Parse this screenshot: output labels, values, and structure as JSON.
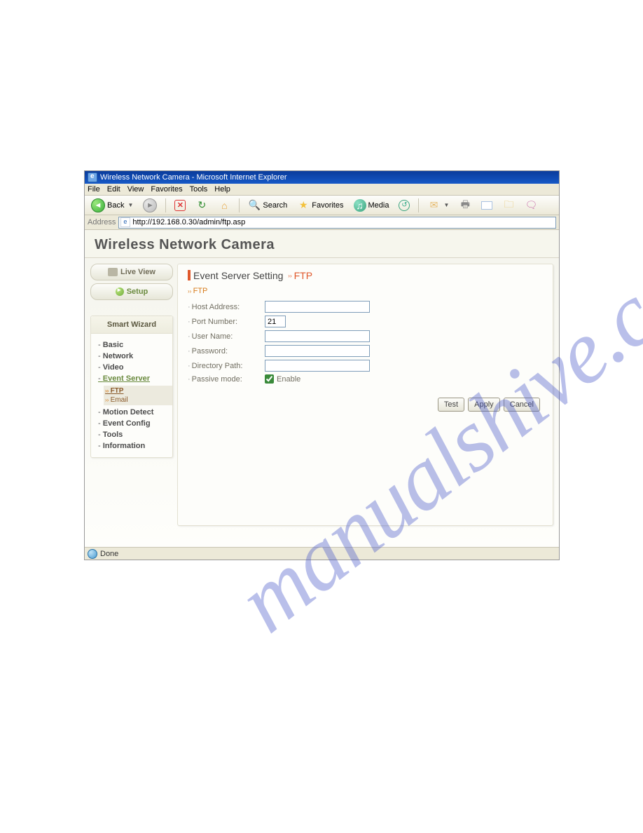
{
  "window": {
    "title": "Wireless Network Camera - Microsoft Internet Explorer"
  },
  "menus": {
    "file": "File",
    "edit": "Edit",
    "view": "View",
    "favorites": "Favorites",
    "tools": "Tools",
    "help": "Help"
  },
  "toolbar": {
    "back": "Back",
    "search": "Search",
    "favorites": "Favorites",
    "media": "Media"
  },
  "address": {
    "label": "Address",
    "url": "http://192.168.0.30/admin/ftp.asp"
  },
  "page": {
    "title": "Wireless Network Camera",
    "liveview": "Live View",
    "setup": "Setup",
    "smartwizard": "Smart Wizard",
    "nav": {
      "basic": "Basic",
      "network": "Network",
      "video": "Video",
      "eventserver": "Event Server",
      "ftp": "FTP",
      "email": "Email",
      "motiondetect": "Motion Detect",
      "eventconfig": "Event Config",
      "tools": "Tools",
      "information": "Information"
    },
    "heading": {
      "main": "Event Server Setting ",
      "sub": "FTP"
    },
    "section": "FTP",
    "fields": {
      "host": {
        "label": "Host Address:",
        "value": ""
      },
      "port": {
        "label": "Port Number:",
        "value": "21"
      },
      "user": {
        "label": "User Name:",
        "value": ""
      },
      "pass": {
        "label": "Password:",
        "value": ""
      },
      "dir": {
        "label": "Directory Path:",
        "value": ""
      },
      "passive": {
        "label": "Passive mode:",
        "enable": "Enable",
        "checked": true
      }
    },
    "buttons": {
      "test": "Test",
      "apply": "Apply",
      "cancel": "Cancel"
    }
  },
  "status": {
    "done": "Done"
  },
  "watermark": "manualshive.com"
}
